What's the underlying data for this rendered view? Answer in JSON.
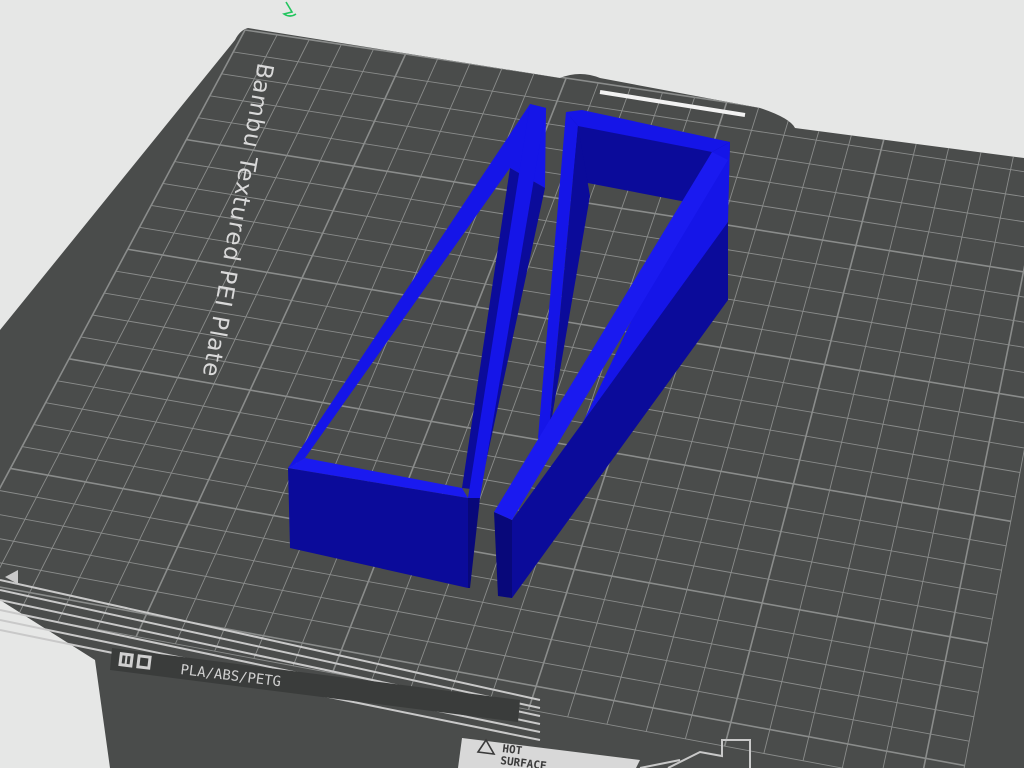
{
  "plate": {
    "title": "Bambu Textured PEI Plate",
    "materials": "PLA/ABS/PETG",
    "hot_line1": "HOT",
    "hot_line2": "SURFACE",
    "plate_color": "#4a4c4b",
    "grid_color": "#8a8c8b"
  },
  "model": {
    "color": "#1515e8",
    "shade_color": "#0b0b9a",
    "dark_color": "#08087a"
  },
  "icons": {
    "plate_logo": "bambu-logo-icon",
    "warning": "warning-triangle-icon",
    "gizmo": "axis-gizmo-icon"
  }
}
